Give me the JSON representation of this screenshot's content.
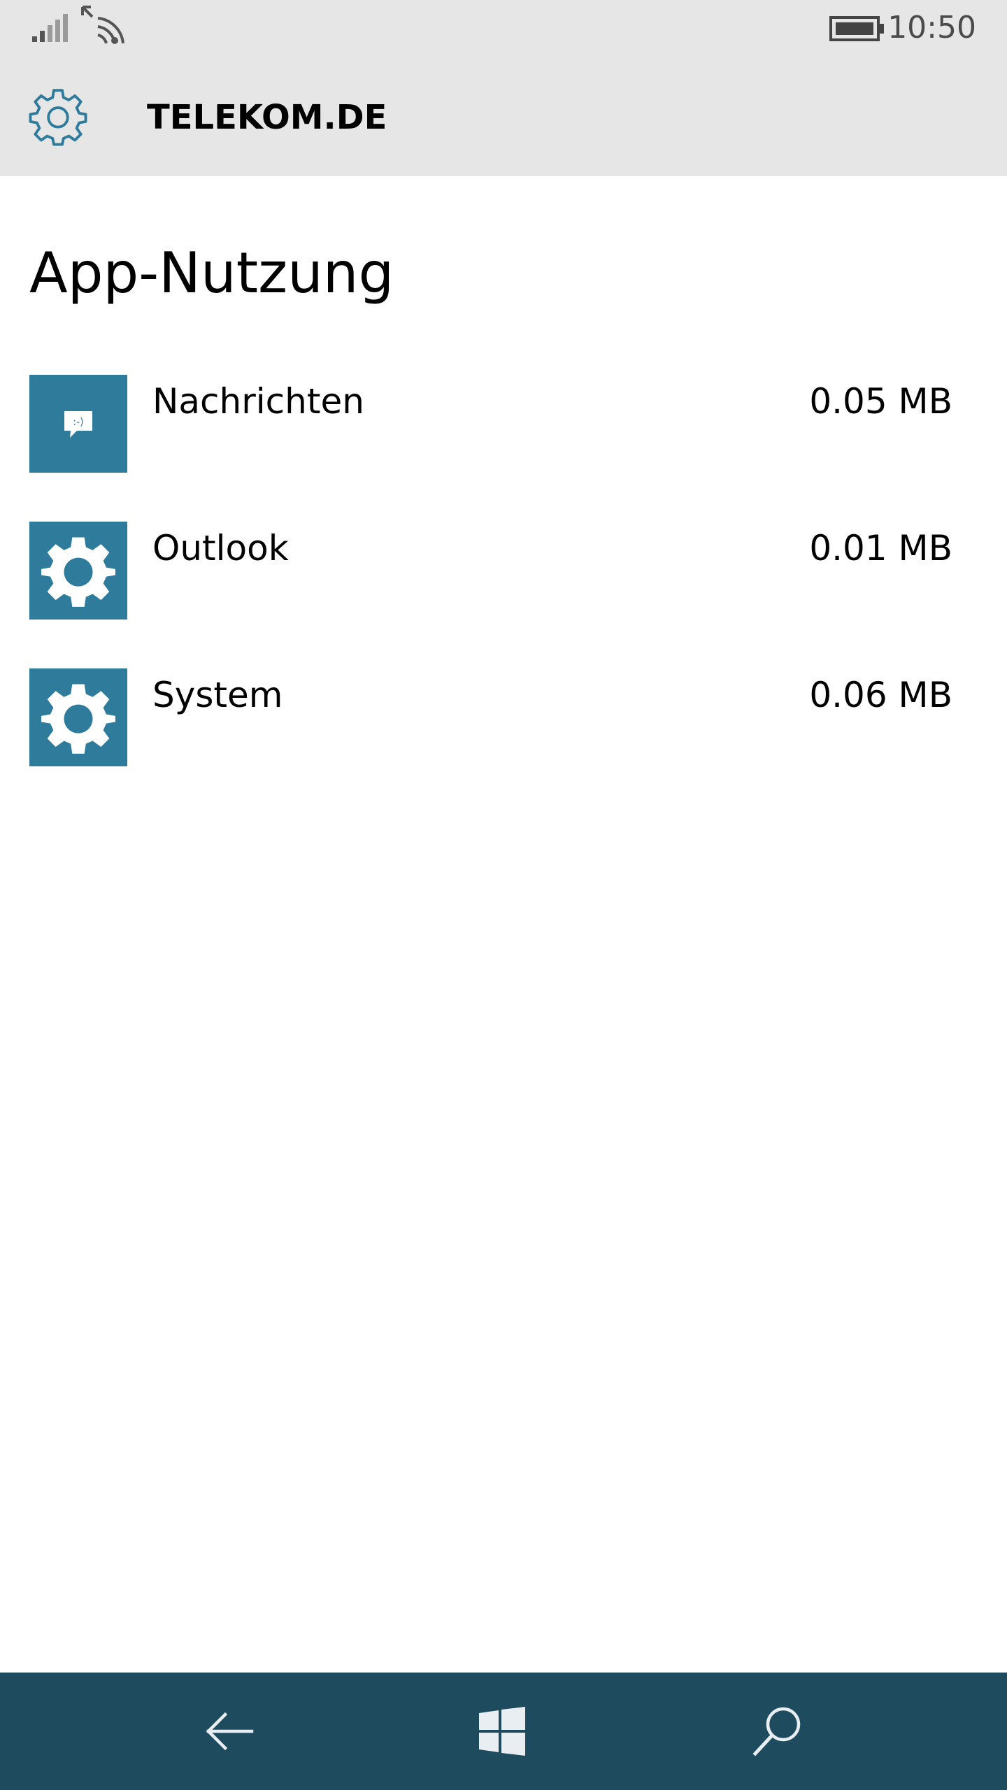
{
  "status_bar": {
    "time": "10:50",
    "icons": [
      "signal-strength-icon",
      "wifi-icon",
      "battery-icon"
    ]
  },
  "header": {
    "icon": "gear-icon",
    "title": "TELEKOM.DE"
  },
  "main": {
    "title": "App-Nutzung",
    "apps": [
      {
        "icon": "messaging-icon",
        "name": "Nachrichten",
        "usage": "0.05 MB"
      },
      {
        "icon": "gear-icon",
        "name": "Outlook",
        "usage": "0.01 MB"
      },
      {
        "icon": "gear-icon",
        "name": "System",
        "usage": "0.06 MB"
      }
    ]
  },
  "nav_bar": {
    "buttons": [
      "back-arrow-icon",
      "windows-start-icon",
      "search-icon"
    ]
  },
  "colors": {
    "accent": "#2e7b9c",
    "header_background": "#e6e6e6",
    "nav_background": "#1f4b5f"
  }
}
